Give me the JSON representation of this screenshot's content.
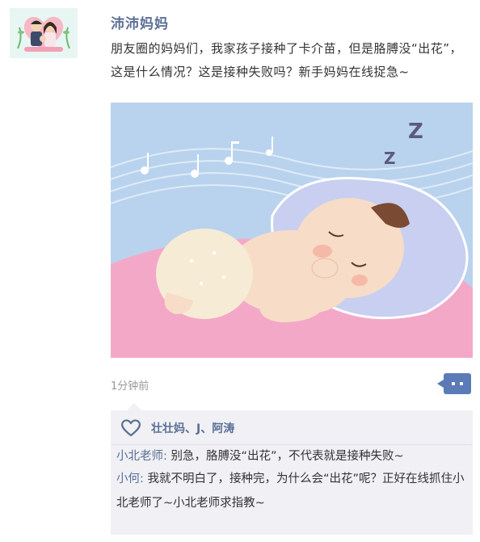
{
  "post": {
    "author": "沛沛妈妈",
    "text": "朋友圈的妈妈们，我家孩子接种了卡介苗，但是胳膊没“出花”，这是什么情况？这是接种失败吗？新手妈妈在线捉急~",
    "time": "1分钟前"
  },
  "likes": {
    "names": "壮壮妈、J、阿涛"
  },
  "comments": [
    {
      "name": "小北老师:",
      "text": "别急，胳膊没“出花”，不代表就是接种失败~"
    },
    {
      "name": "小何:",
      "text": "我就不明白了，接种完，为什么会“出花”呢？正好在线抓住小北老师了~小北老师求指教~"
    }
  ],
  "colors": {
    "name_blue": "#5b6f95",
    "more_button": "#5b7ab8",
    "comment_bg": "#f0f0f5",
    "photo_sky": "#b9d3ee",
    "photo_blanket": "#f4a8c8"
  },
  "icons": {
    "avatar": "family-avatar",
    "like": "heart-icon",
    "more": "more-dots-icon"
  }
}
